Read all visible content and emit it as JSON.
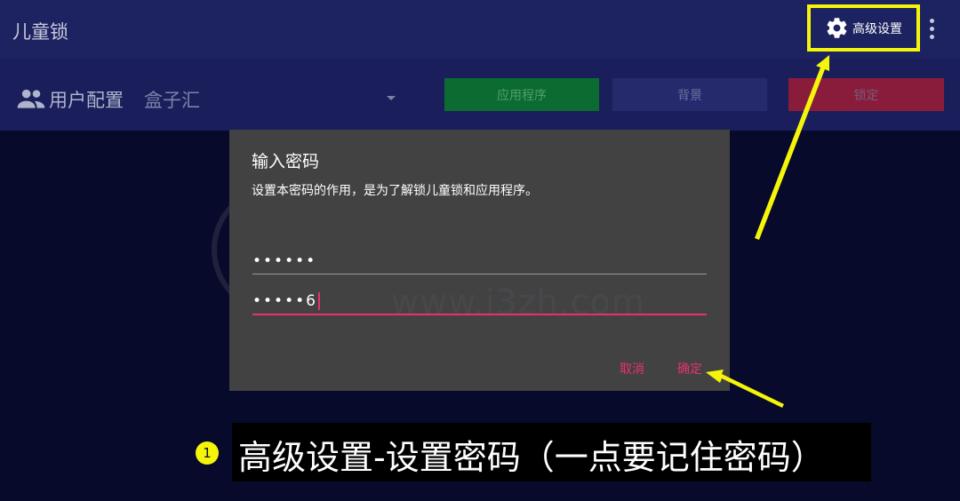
{
  "app": {
    "title": "儿童锁"
  },
  "toolbar": {
    "advanced_label": "高级设置",
    "icons": {
      "settings": "gear-icon",
      "more": "more-vert-icon"
    }
  },
  "profile": {
    "label": "用户配置",
    "selected": "盒子汇",
    "icon": "people-icon"
  },
  "actions": {
    "apps": "应用程序",
    "background": "背景",
    "lock": "锁定"
  },
  "dialog": {
    "title": "输入密码",
    "message": "设置本密码的作用，是为了解锁儿童锁和应用程序。",
    "password1": "••••••",
    "password2": "•••••6",
    "cancel": "取消",
    "ok": "确定"
  },
  "watermark": {
    "text": "www.i3zh.com"
  },
  "annotation": {
    "step": "1",
    "caption": "高级设置-设置密码（一点要记住密码）"
  },
  "colors": {
    "topbar": "#1d2260",
    "accent": "#e8316d",
    "highlight": "#f5f50a",
    "dialog": "#424242"
  }
}
